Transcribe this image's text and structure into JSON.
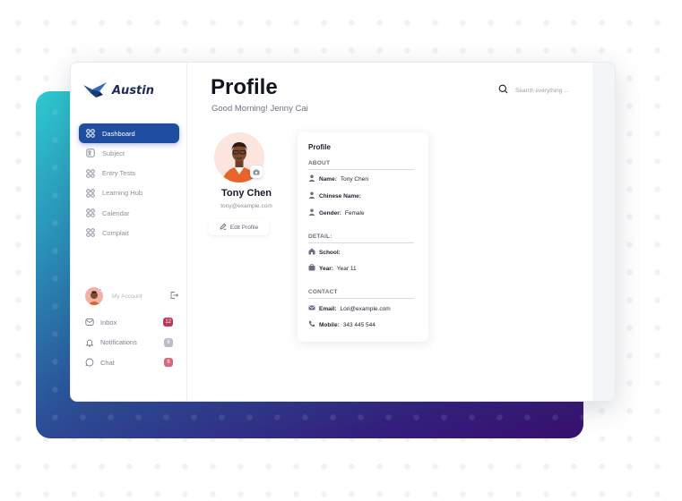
{
  "app": {
    "name": "Austin"
  },
  "nav": [
    {
      "label": "Dashboard",
      "icon": "grid-icon",
      "active": true
    },
    {
      "label": "Subject",
      "icon": "subject-icon"
    },
    {
      "label": "Entry Tests",
      "icon": "grid-icon"
    },
    {
      "label": "Learning Hub",
      "icon": "grid-icon"
    },
    {
      "label": "Calendar",
      "icon": "grid-icon"
    },
    {
      "label": "Complait",
      "icon": "grid-icon"
    }
  ],
  "account": {
    "label": "My Account"
  },
  "bottom_nav": [
    {
      "label": "Inbox",
      "icon": "inbox-icon",
      "badge": "12",
      "badge_color": "#c0395a"
    },
    {
      "label": "Notifications",
      "icon": "bell-icon",
      "badge": "6",
      "badge_color": "#b9bdc8"
    },
    {
      "label": "Chat",
      "icon": "chat-icon",
      "badge": "6",
      "badge_color": "#d9687e"
    }
  ],
  "header": {
    "title": "Profile",
    "greeting": "Good Morning! Jenny Cai",
    "search_placeholder": "Search everything ..."
  },
  "profile": {
    "name": "Tony Chen",
    "email": "tony@example.com",
    "edit_label": "Edit Profile"
  },
  "info": {
    "title": "Profile",
    "about": {
      "heading": "ABOUT",
      "name_key": "Name:",
      "name_val": "Tony Chen",
      "chinese_key": "Chinese Name:",
      "chinese_val": "",
      "gender_key": "Gender:",
      "gender_val": "Female"
    },
    "detail": {
      "heading": "DETAIL:",
      "school_key": "School:",
      "school_val": "",
      "year_key": "Year:",
      "year_val": "Year 11"
    },
    "contact": {
      "heading": "CONTACT",
      "email_key": "Email:",
      "email_val": "Lori@example.com",
      "mobile_key": "Mobile:",
      "mobile_val": "343 445 544"
    }
  },
  "colors": {
    "accent": "#1f4ea0",
    "brand": "#1c2a55"
  }
}
